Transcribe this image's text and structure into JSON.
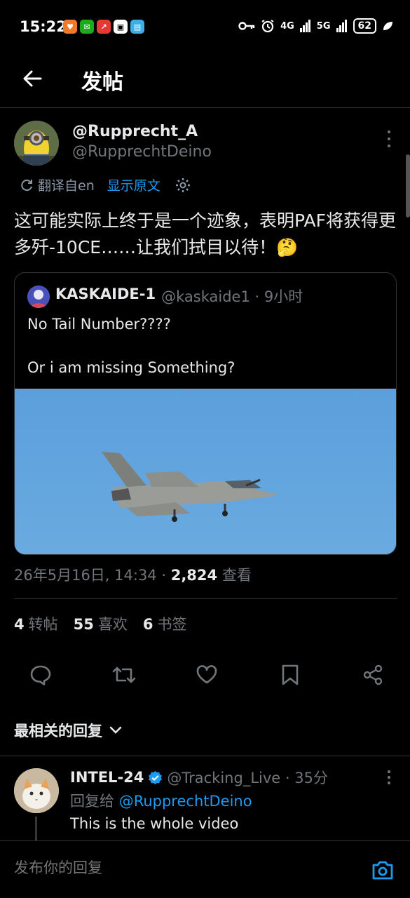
{
  "status_bar": {
    "time": "15:22",
    "network_4g": "4G",
    "network_5g": "5G",
    "battery": "62",
    "apps": [
      {
        "icon": "app-orange-icon",
        "color": "#f07a2a"
      },
      {
        "icon": "wechat-icon",
        "color": "#1aad19"
      },
      {
        "icon": "stocks-icon",
        "color": "#e53935"
      },
      {
        "icon": "app-white-icon",
        "color": "#ffffff"
      },
      {
        "icon": "book-icon",
        "color": "#3ab0e6"
      }
    ]
  },
  "header": {
    "title": "发帖"
  },
  "post": {
    "author_name": "@Rupprecht_A",
    "author_handle": "@RupprechtDeino",
    "translate_from": "翻译自en",
    "show_original": "显示原文",
    "text": "这可能实际上终于是一个迹象，表明PAF将获得更多歼-10CE……让我们拭目以待！🤔",
    "quote": {
      "name": "KASKAIDE-1",
      "meta": "@kaskaide1 · 9小时",
      "text": "No Tail Number????\n\nOr i am missing Something?"
    },
    "meta_date": "26年5月16日, 14:34 · ",
    "views_count": "2,824",
    "views_label": " 查看",
    "stats": {
      "reposts_count": "4",
      "reposts_label": "转帖",
      "likes_count": "55",
      "likes_label": "喜欢",
      "bookmarks_count": "6",
      "bookmarks_label": "书签"
    }
  },
  "replies_sort": "最相关的回复",
  "reply": {
    "name": "INTEL-24",
    "meta": "@Tracking_Live · 35分",
    "reply_to_prefix": "回复给 ",
    "reply_to_handle": "@RupprechtDeino",
    "text": "This is the whole video"
  },
  "compose": {
    "placeholder": "发布你的回复"
  },
  "colors": {
    "accent": "#1d9bf0",
    "background": "#000000",
    "secondary_text": "#71767b"
  }
}
